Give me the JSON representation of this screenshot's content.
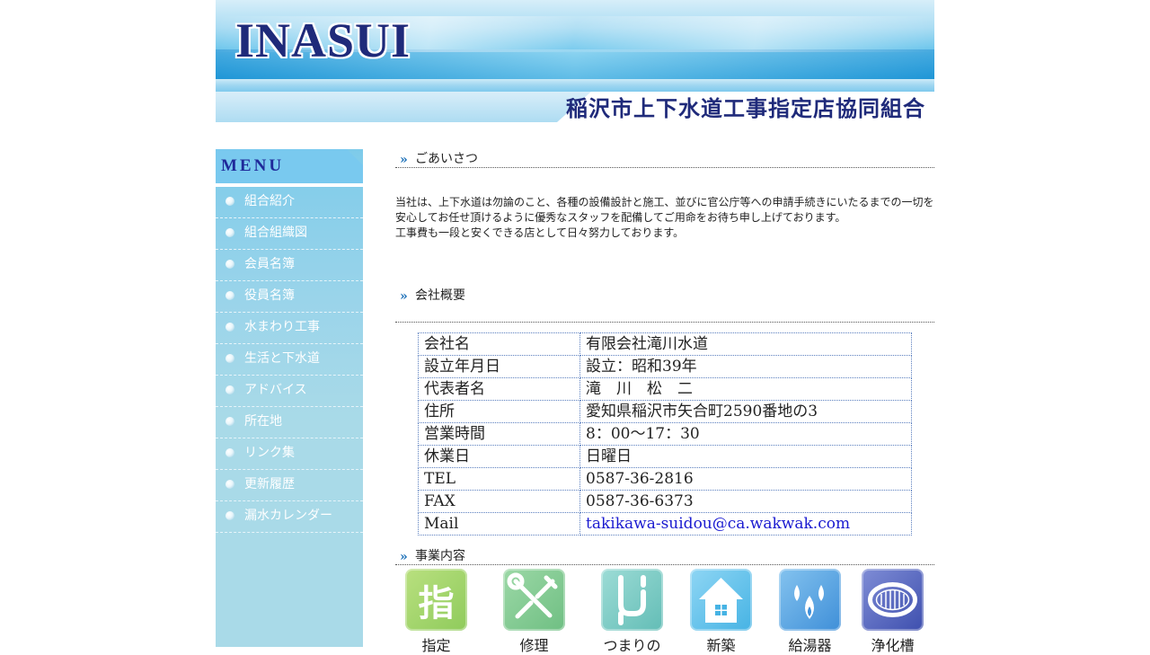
{
  "header": {
    "logo": "INASUI",
    "org_name": "稲沢市上下水道工事指定店協同組合"
  },
  "sidebar": {
    "menu_title": "MENU",
    "items": [
      {
        "label": "組合紹介"
      },
      {
        "label": "組合組織図"
      },
      {
        "label": "会員名簿"
      },
      {
        "label": "役員名簿"
      },
      {
        "label": "水まわり工事"
      },
      {
        "label": "生活と下水道"
      },
      {
        "label": "アドバイス"
      },
      {
        "label": "所在地"
      },
      {
        "label": "リンク集"
      },
      {
        "label": "更新履歴"
      },
      {
        "label": "漏水カレンダー"
      }
    ]
  },
  "main": {
    "greeting": {
      "heading": "ごあいさつ",
      "lines": [
        "当社は、上下水道は勿論のこと、各種の設備設計と施工、並びに官公庁等への申請手続きにいたるまでの一切を",
        "安心してお任せ頂けるように優秀なスタッフを配備してご用命をお待ち申し上げております。",
        "工事費も一段と安くできる店として日々努力しております。"
      ]
    },
    "profile": {
      "heading": "会社概要",
      "rows": [
        {
          "key": "会社名",
          "value": "有限会社滝川水道"
        },
        {
          "key": "設立年月日",
          "value": "設立：昭和39年"
        },
        {
          "key": "代表者名",
          "value": "滝　川　松　二"
        },
        {
          "key": "住所",
          "value": "愛知県稲沢市矢合町2590番地の3"
        },
        {
          "key": "営業時間",
          "value": "8：00～17：30"
        },
        {
          "key": "休業日",
          "value": "日曜日"
        },
        {
          "key": "TEL",
          "value": "0587-36-2816"
        },
        {
          "key": "FAX",
          "value": "0587-36-6373"
        },
        {
          "key": "Mail",
          "value": "takikawa-suidou@ca.wakwak.com"
        }
      ]
    },
    "business": {
      "heading": "事業内容",
      "items": [
        {
          "caption": "指定",
          "icon": "designated-icon",
          "glyph": "指",
          "color": "#9fd36a"
        },
        {
          "caption": "修理",
          "icon": "wrench-icon",
          "glyph": "",
          "color": "#7fc98f"
        },
        {
          "caption": "つまりの",
          "icon": "pipe-icon",
          "glyph": "",
          "color": "#7ccbc4"
        },
        {
          "caption": "新築",
          "icon": "house-icon",
          "glyph": "",
          "color": "#5fbfe8"
        },
        {
          "caption": "給湯器",
          "icon": "flame-water-icon",
          "glyph": "",
          "color": "#5aa6e0"
        },
        {
          "caption": "浄化槽",
          "icon": "septic-tank-icon",
          "glyph": "",
          "color": "#5f6fc0"
        }
      ]
    }
  }
}
